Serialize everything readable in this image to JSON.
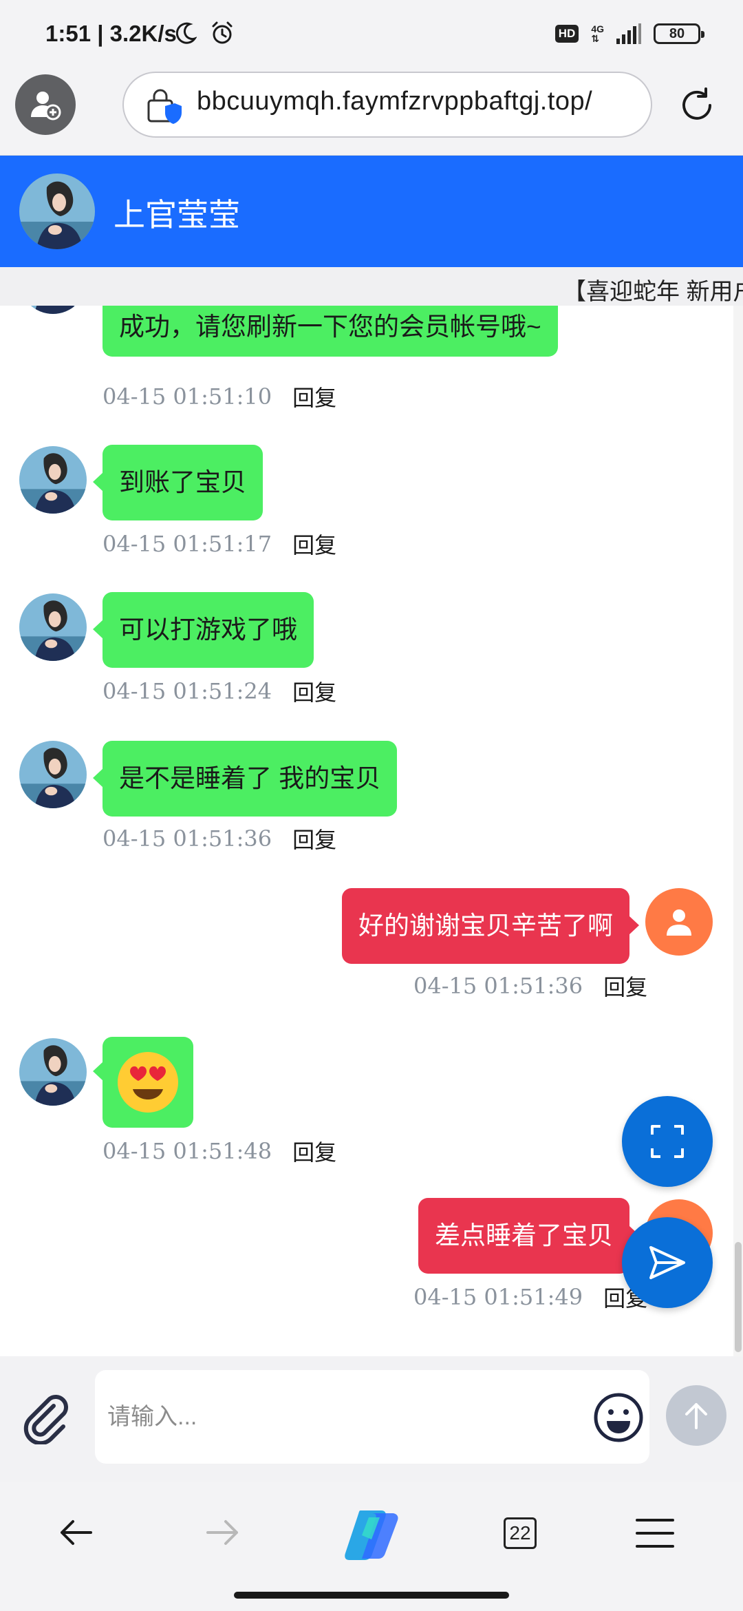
{
  "status_bar": {
    "time_speed": "1:51 | 3.2K/s",
    "hd_badge": "HD",
    "network_type": "4G",
    "battery": "80"
  },
  "browser": {
    "url": "bbcuuymqh.faymfzrvppbaftgj.top/"
  },
  "chat": {
    "contact_name": "上官莹莹",
    "marquee": "【喜迎蛇年 新用户"
  },
  "messages": [
    {
      "side": "left",
      "text": "成功，请您刷新一下您的会员帐号哦~",
      "time": "04-15 01:51:10",
      "reply": "回复"
    },
    {
      "side": "left",
      "text": "到账了宝贝",
      "time": "04-15 01:51:17",
      "reply": "回复"
    },
    {
      "side": "left",
      "text": "可以打游戏了哦",
      "time": "04-15 01:51:24",
      "reply": "回复"
    },
    {
      "side": "left",
      "text": "是不是睡着了 我的宝贝",
      "time": "04-15 01:51:36",
      "reply": "回复"
    },
    {
      "side": "right",
      "text": "好的谢谢宝贝辛苦了啊",
      "time": "04-15 01:51:36",
      "reply": "回复"
    },
    {
      "side": "left",
      "emoji": "heart-eyes-emoji",
      "time": "04-15 01:51:48",
      "reply": "回复"
    },
    {
      "side": "right",
      "text": "差点睡着了宝贝",
      "time": "04-15 01:51:49",
      "reply": "回复"
    }
  ],
  "input": {
    "placeholder": "请输入..."
  },
  "bottom_nav": {
    "tabs_count": "22"
  },
  "colors": {
    "header_blue": "#1a6cff",
    "bubble_green": "#4cee62",
    "bubble_red": "#e9354f",
    "fab_blue": "#0a6fd8",
    "user_avatar": "#ff7a45"
  }
}
